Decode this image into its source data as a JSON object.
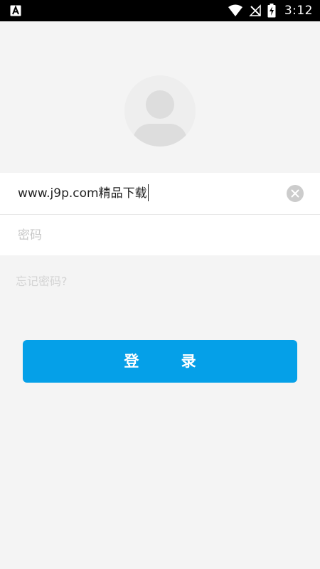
{
  "status_bar": {
    "time": "3:12",
    "app_icon": "a-letter-icon",
    "icons": [
      "wifi-icon",
      "no-signal-icon",
      "battery-charging-icon"
    ]
  },
  "avatar": {
    "icon": "user-avatar-icon"
  },
  "login_form": {
    "username_value": "www.j9p.com精品下载",
    "password_placeholder": "密码",
    "clear_icon": "close-icon"
  },
  "forgot_password": "忘记密码?",
  "login_button": "登 录",
  "colors": {
    "accent": "#05a0e8",
    "background": "#f4f4f4",
    "status_bar": "#000000"
  }
}
